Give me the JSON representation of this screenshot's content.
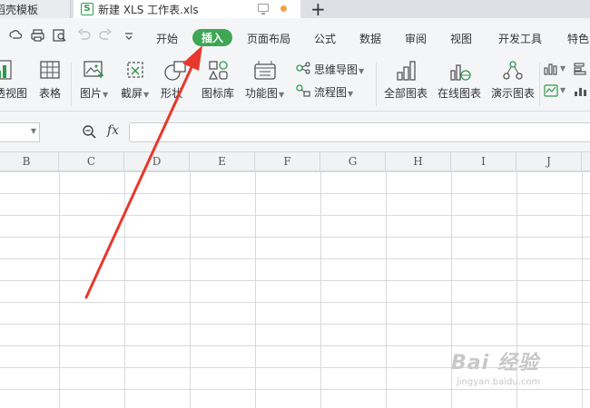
{
  "titlebar": {
    "tabs": [
      {
        "label": "稻壳模板"
      },
      {
        "label": "新建 XLS 工作表.xls"
      }
    ],
    "xls_glyph": "S",
    "new_tab_label": "+",
    "accent_color": "#2f9a4d",
    "unsaved_color": "#f0a24a"
  },
  "menubar": {
    "items": [
      "开始",
      "插入",
      "页面布局",
      "公式",
      "数据",
      "审阅",
      "视图",
      "开发工具",
      "特色"
    ],
    "active": "插入",
    "active_color": "#3fa654",
    "quick_access_icons": [
      "cloud-sync-icon",
      "print-icon",
      "print-preview-icon",
      "undo-icon",
      "redo-icon",
      "more-icon"
    ]
  },
  "ribbon": {
    "buttons": [
      {
        "label": "透视图"
      },
      {
        "label": "表格"
      },
      {
        "label": "图片"
      },
      {
        "label": "截屏"
      },
      {
        "label": "形状"
      },
      {
        "label": "图标库"
      },
      {
        "label": "功能图"
      },
      {
        "label": "思维导图"
      },
      {
        "label": "流程图"
      },
      {
        "label": "全部图表"
      },
      {
        "label": "在线图表"
      },
      {
        "label": "演示图表"
      }
    ]
  },
  "formula": {
    "fx_label": "fx",
    "name_box_value": "",
    "formula_value": ""
  },
  "grid": {
    "columns": [
      "B",
      "C",
      "D",
      "E",
      "F",
      "G",
      "H",
      "I",
      "J"
    ]
  },
  "annotation": {
    "arrow_color": "#e8382c",
    "target": "插入"
  },
  "watermark": {
    "main": "Bai 经验",
    "sub": "jingyan.baidu.com"
  }
}
